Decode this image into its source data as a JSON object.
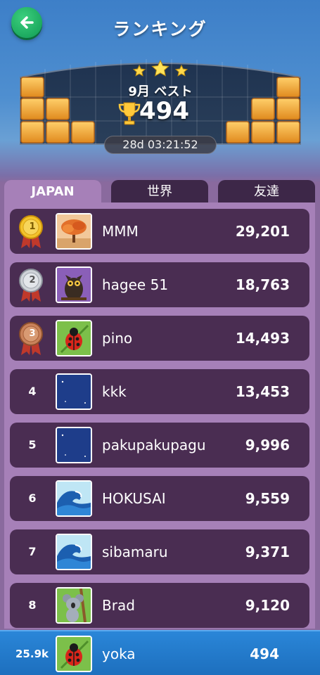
{
  "header": {
    "title": "ランキング"
  },
  "best": {
    "label": "9月 ベスト",
    "score": "494",
    "timer": "28d 03:21:52"
  },
  "tabs": [
    {
      "label": "JAPAN",
      "active": true
    },
    {
      "label": "世界",
      "active": false
    },
    {
      "label": "友達",
      "active": false
    }
  ],
  "ranking": [
    {
      "rank": "1",
      "name": "MMM",
      "score": "29,201",
      "avatar": "autumn-tree-icon",
      "medal": "gold"
    },
    {
      "rank": "2",
      "name": "hagee 51",
      "score": "18,763",
      "avatar": "owl-icon",
      "medal": "silver"
    },
    {
      "rank": "3",
      "name": "pino",
      "score": "14,493",
      "avatar": "ladybug-icon",
      "medal": "bronze"
    },
    {
      "rank": "4",
      "name": "kkk",
      "score": "13,453",
      "avatar": "moon-icon"
    },
    {
      "rank": "5",
      "name": "pakupakupagu",
      "score": "9,996",
      "avatar": "moon-icon"
    },
    {
      "rank": "6",
      "name": "HOKUSAI",
      "score": "9,559",
      "avatar": "wave-icon"
    },
    {
      "rank": "7",
      "name": "sibamaru",
      "score": "9,371",
      "avatar": "wave-icon"
    },
    {
      "rank": "8",
      "name": "Brad",
      "score": "9,120",
      "avatar": "koala-icon"
    }
  ],
  "me": {
    "rank": "25.9k",
    "name": "yoka",
    "score": "494",
    "avatar": "ladybug-icon"
  },
  "colors": {
    "accent_green": "#1fb366",
    "row_bg": "#4a2d52",
    "list_bg": "#a680b8",
    "me_bar": "#2a86d8"
  }
}
